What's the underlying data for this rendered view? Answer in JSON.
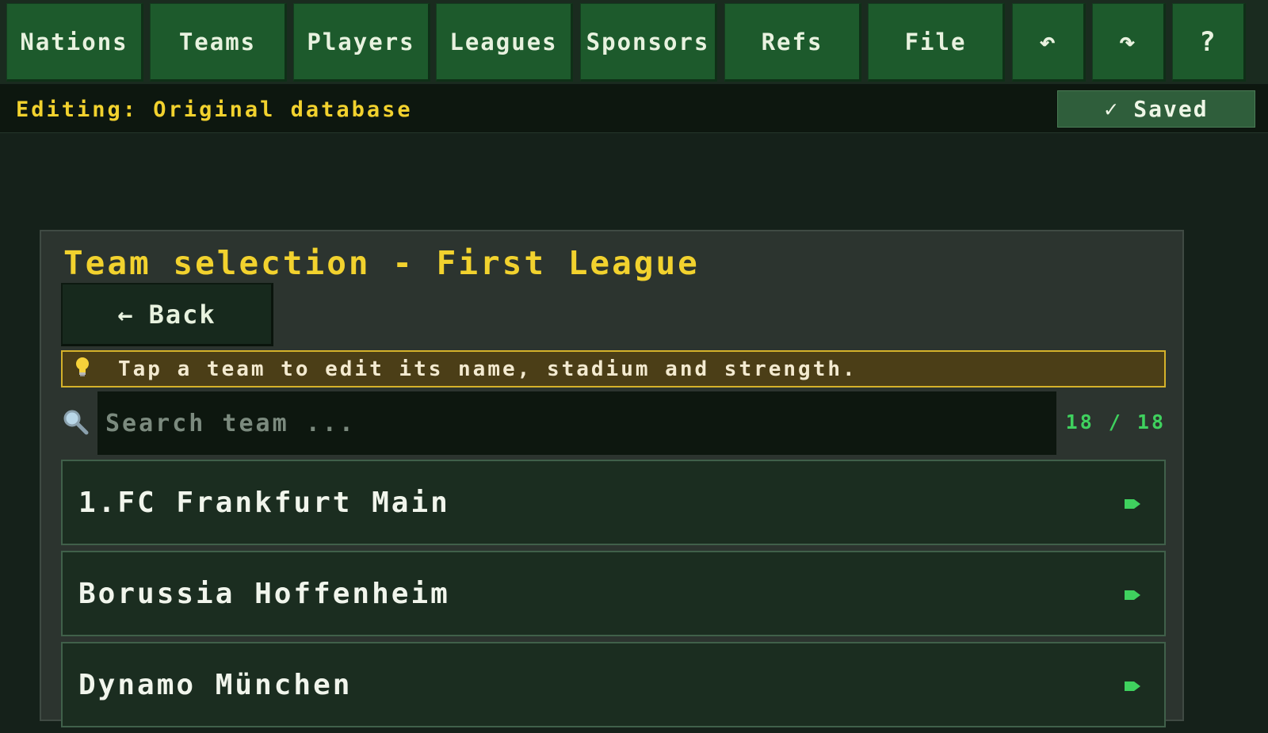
{
  "nav": {
    "items": [
      {
        "label": "Nations"
      },
      {
        "label": "Teams"
      },
      {
        "label": "Players"
      },
      {
        "label": "Leagues"
      },
      {
        "label": "Sponsors"
      },
      {
        "label": "Refs"
      },
      {
        "label": "File"
      },
      {
        "label": "↶",
        "icon": "undo-icon"
      },
      {
        "label": "↷",
        "icon": "redo-icon"
      },
      {
        "label": "?",
        "icon": "help-icon"
      }
    ]
  },
  "status": {
    "editing": "Editing: Original database",
    "saved_check": "✓",
    "saved_label": "Saved"
  },
  "panel": {
    "title": "Team selection - First League",
    "back_arrow": "←",
    "back_label": "Back",
    "hint_icon": "lightbulb-icon",
    "hint": "Tap a team to edit its name, stadium and strength.",
    "search": {
      "icon": "search-icon",
      "placeholder": "Search team ...",
      "value": ""
    },
    "count": "18 / 18",
    "teams": [
      {
        "name": "1.FC Frankfurt Main"
      },
      {
        "name": "Borussia Hoffenheim"
      },
      {
        "name": "Dynamo München"
      }
    ]
  },
  "colors": {
    "accent_yellow": "#f2d22e",
    "nav_green": "#1d5a2c",
    "count_green": "#3fd15e",
    "hint_border": "#d5b22a"
  }
}
